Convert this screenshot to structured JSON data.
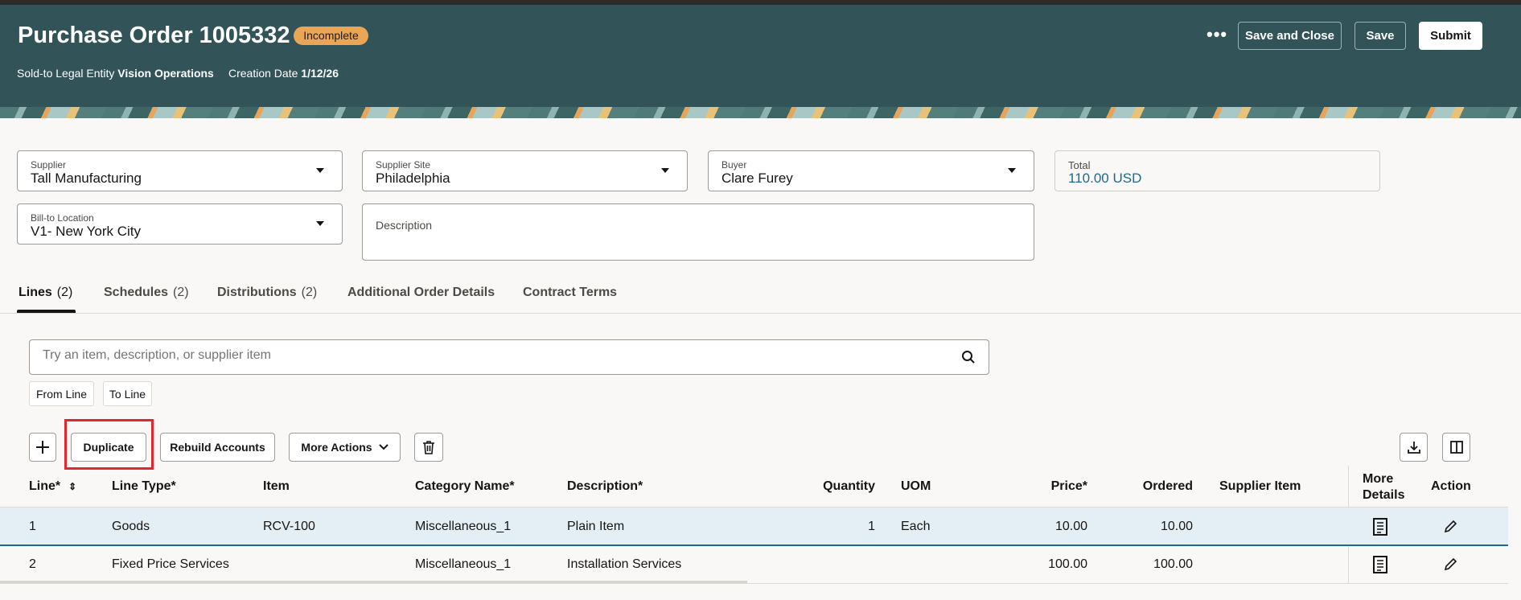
{
  "header": {
    "title": "Purchase Order 1005332",
    "status": "Incomplete",
    "sold_to_label": "Sold-to Legal Entity",
    "sold_to_value": "Vision Operations",
    "creation_label": "Creation Date",
    "creation_value": "1/12/26",
    "more_label": "•••",
    "save_close": "Save and Close",
    "save": "Save",
    "submit": "Submit"
  },
  "form": {
    "supplier": {
      "label": "Supplier",
      "value": "Tall Manufacturing"
    },
    "supplier_site": {
      "label": "Supplier Site",
      "value": "Philadelphia"
    },
    "buyer": {
      "label": "Buyer",
      "value": "Clare Furey"
    },
    "total": {
      "label": "Total",
      "value": "110.00 USD"
    },
    "bill_to": {
      "label": "Bill-to Location",
      "value": "V1- New York City"
    },
    "description": {
      "label": "Description",
      "value": ""
    }
  },
  "tabs": [
    {
      "label": "Lines",
      "count": "(2)"
    },
    {
      "label": "Schedules",
      "count": "(2)"
    },
    {
      "label": "Distributions",
      "count": "(2)"
    },
    {
      "label": "Additional Order Details"
    },
    {
      "label": "Contract Terms"
    }
  ],
  "search": {
    "placeholder": "Try an item, description, or supplier item",
    "chips": [
      "From Line",
      "To Line"
    ]
  },
  "toolbar": {
    "duplicate": "Duplicate",
    "rebuild": "Rebuild Accounts",
    "more_actions": "More Actions"
  },
  "table": {
    "headers": {
      "line": "Line*",
      "line_type": "Line Type*",
      "item": "Item",
      "category": "Category Name*",
      "description": "Description*",
      "quantity": "Quantity",
      "uom": "UOM",
      "price": "Price*",
      "ordered": "Ordered",
      "supplier_item": "Supplier Item",
      "more_details_1": "More",
      "more_details_2": "Details",
      "action": "Action"
    },
    "rows": [
      {
        "line": "1",
        "line_type": "Goods",
        "item": "RCV-100",
        "category": "Miscellaneous_1",
        "description": "Plain Item",
        "quantity": "1",
        "uom": "Each",
        "price": "10.00",
        "ordered": "10.00",
        "supplier_item": ""
      },
      {
        "line": "2",
        "line_type": "Fixed Price Services",
        "item": "",
        "category": "Miscellaneous_1",
        "description": "Installation Services",
        "quantity": "",
        "uom": "",
        "price": "100.00",
        "ordered": "100.00",
        "supplier_item": ""
      }
    ]
  },
  "colors": {
    "header_bg": "#325459",
    "badge": "#eba655",
    "selected_row": "#e3eff5",
    "total_value": "#1c6a8f",
    "highlight": "#e0272b"
  }
}
